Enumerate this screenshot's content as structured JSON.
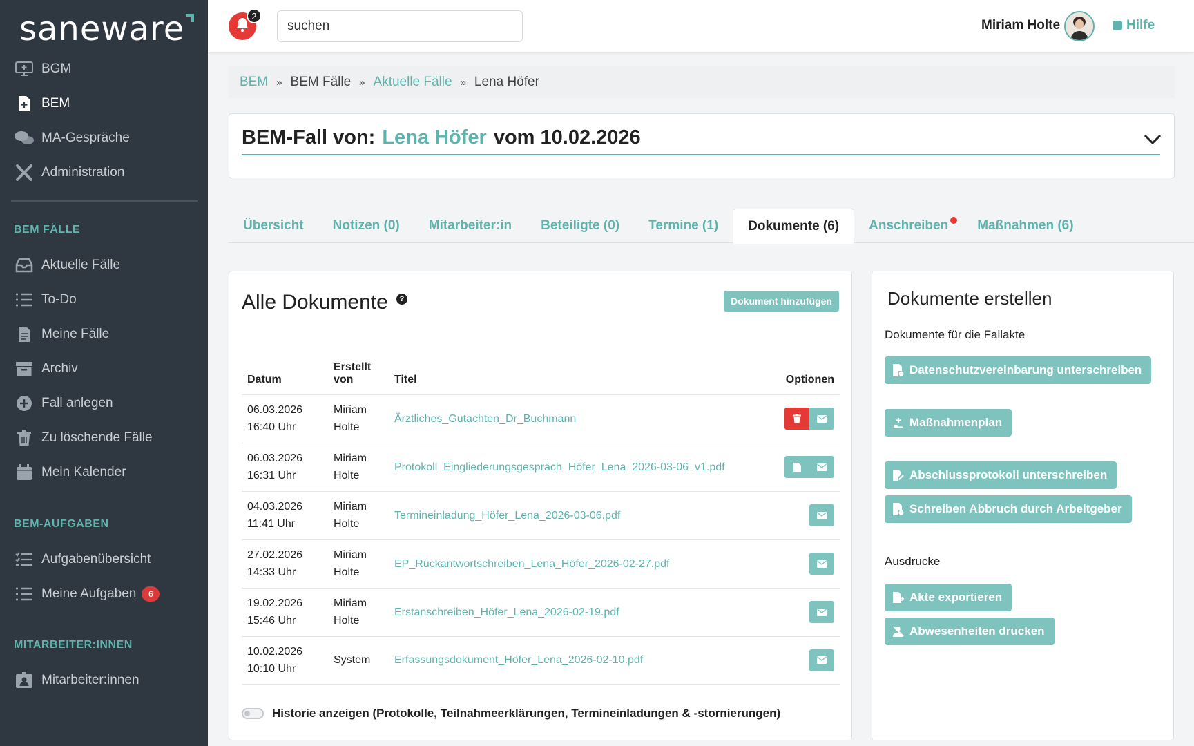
{
  "app": {
    "logo": "saneware"
  },
  "sidebar": {
    "top_items": [
      {
        "label": "BGM",
        "icon": "monitor-plus-icon"
      },
      {
        "label": "BEM",
        "icon": "file-plus-icon",
        "active": true
      },
      {
        "label": "MA-Gespräche",
        "icon": "chat-bubbles-icon"
      },
      {
        "label": "Administration",
        "icon": "tools-icon"
      }
    ],
    "sections": [
      {
        "heading": "BEM FÄLLE",
        "items": [
          {
            "label": "Aktuelle Fälle",
            "icon": "inbox-icon"
          },
          {
            "label": "To-Do",
            "icon": "list-icon"
          },
          {
            "label": "Meine Fälle",
            "icon": "document-icon"
          },
          {
            "label": "Archiv",
            "icon": "archive-icon"
          },
          {
            "label": "Fall anlegen",
            "icon": "plus-circle-icon"
          },
          {
            "label": "Zu löschende Fälle",
            "icon": "trash-icon"
          },
          {
            "label": "Mein Kalender",
            "icon": "calendar-icon"
          }
        ]
      },
      {
        "heading": "BEM-AUFGABEN",
        "items": [
          {
            "label": "Aufgabenübersicht",
            "icon": "checklist-icon"
          },
          {
            "label": "Meine Aufgaben",
            "icon": "list-icon",
            "badge": "6"
          }
        ]
      },
      {
        "heading": "MITARBEITER:INNEN",
        "items": [
          {
            "label": "Mitarbeiter:innen",
            "icon": "id-card-icon"
          }
        ]
      }
    ]
  },
  "topbar": {
    "notification_count": "2",
    "search_value": "suchen",
    "user_name": "Miriam Holte",
    "help_label": "Hilfe"
  },
  "breadcrumb": {
    "items": [
      "BEM",
      "BEM Fälle",
      "Aktuelle Fälle",
      "Lena Höfer"
    ],
    "separator": "»"
  },
  "case": {
    "prefix": "BEM-Fall von:",
    "name": "Lena Höfer",
    "suffix": "vom 10.02.2026"
  },
  "tabs": [
    {
      "label": "Übersicht"
    },
    {
      "label": "Notizen (0)"
    },
    {
      "label": "Mitarbeiter:in"
    },
    {
      "label": "Beteiligte (0)"
    },
    {
      "label": "Termine (1)"
    },
    {
      "label": "Dokumente (6)",
      "active": true
    },
    {
      "label": "Anschreiben",
      "dot": true
    },
    {
      "label": "Maßnahmen (6)"
    }
  ],
  "documents": {
    "title": "Alle Dokumente",
    "add_button": "Dokument hinzufügen",
    "columns": {
      "date": "Datum",
      "created_by_1": "Erstellt",
      "created_by_2": "von",
      "title": "Titel",
      "options": "Optionen"
    },
    "rows": [
      {
        "date": "06.03.2026",
        "time": "16:40 Uhr",
        "by1": "Miriam",
        "by2": "Holte",
        "title": "Ärztliches_Gutachten_Dr_Buchmann",
        "options": [
          "delete",
          "mail"
        ]
      },
      {
        "date": "06.03.2026",
        "time": "16:31 Uhr",
        "by1": "Miriam",
        "by2": "Holte",
        "title": "Protokoll_Eingliederungsgespräch_Höfer_Lena_2026-03-06_v1.pdf",
        "options": [
          "file",
          "mail"
        ]
      },
      {
        "date": "04.03.2026",
        "time": "11:41 Uhr",
        "by1": "Miriam",
        "by2": "Holte",
        "title": "Termineinladung_Höfer_Lena_2026-03-06.pdf",
        "options": [
          "mail"
        ]
      },
      {
        "date": "27.02.2026",
        "time": "14:33 Uhr",
        "by1": "Miriam",
        "by2": "Holte",
        "title": "EP_Rückantwortschreiben_Lena_Höfer_2026-02-27.pdf",
        "options": [
          "mail"
        ]
      },
      {
        "date": "19.02.2026",
        "time": "15:46 Uhr",
        "by1": "Miriam",
        "by2": "Holte",
        "title": "Erstanschreiben_Höfer_Lena_2026-02-19.pdf",
        "options": [
          "mail"
        ]
      },
      {
        "date": "10.02.2026",
        "time": "10:10 Uhr",
        "by1": "System",
        "by2": "",
        "title": "Erfassungsdokument_Höfer_Lena_2026-02-10.pdf",
        "options": [
          "mail"
        ]
      }
    ],
    "history_label": "Historie anzeigen (Protokolle, Teilnahmeerklärungen, Termineinladungen & -stornierungen)"
  },
  "create": {
    "title": "Dokumente erstellen",
    "section1": "Dokumente für die Fallakte",
    "buttons1": [
      {
        "label": "Datenschutzvereinbarung unterschreiben",
        "icon": "file-sign-icon"
      },
      {
        "label": "Maßnahmenplan",
        "icon": "hand-plus-icon"
      },
      {
        "label": "Abschlussprotokoll unterschreiben",
        "icon": "file-edit-icon"
      },
      {
        "label": "Schreiben Abbruch durch Arbeitgeber",
        "icon": "file-sign-icon"
      }
    ],
    "section2": "Ausdrucke",
    "buttons2": [
      {
        "label": "Akte exportieren",
        "icon": "file-export-icon"
      },
      {
        "label": "Abwesenheiten drucken",
        "icon": "user-x-icon"
      }
    ]
  },
  "colors": {
    "accent": "#5fb3ad",
    "sidebar": "#2f3740",
    "danger": "#e53935",
    "button": "#7ec3be"
  }
}
